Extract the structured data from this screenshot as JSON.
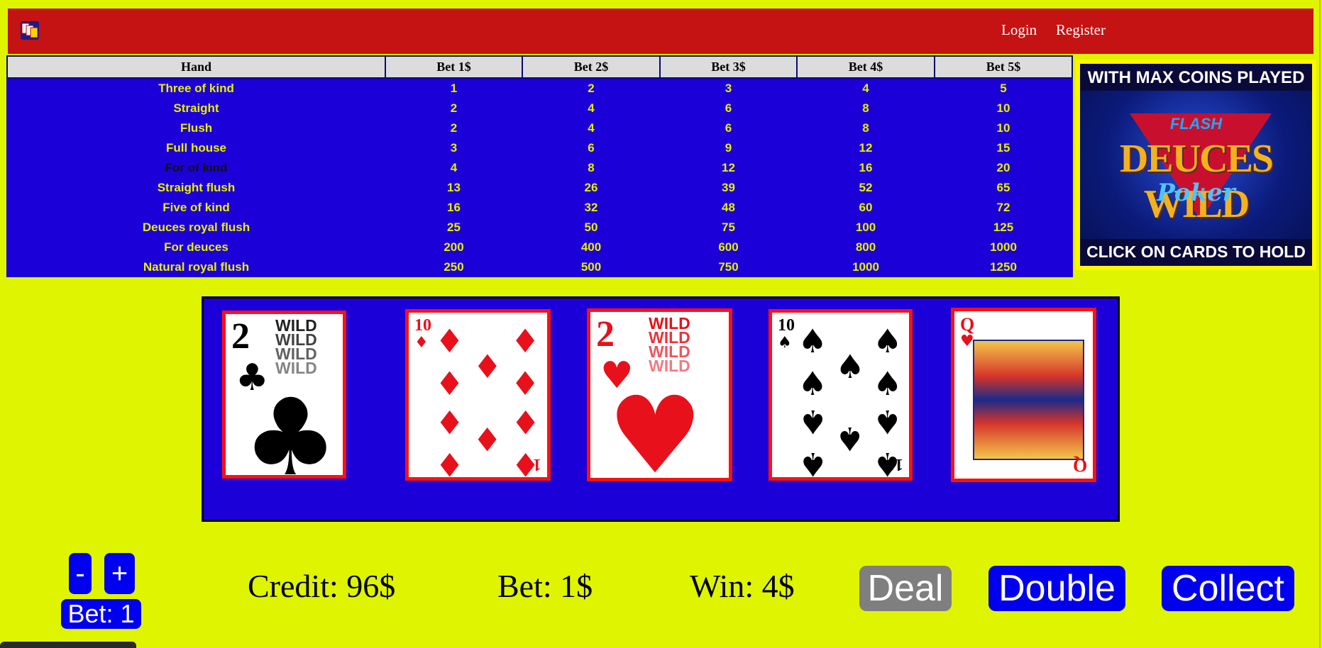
{
  "header": {
    "login_label": "Login",
    "register_label": "Register",
    "colors": {
      "background": "#c51212",
      "text": "#ffffff"
    }
  },
  "paytable": {
    "headers": [
      "Hand",
      "Bet 1$",
      "Bet 2$",
      "Bet 3$",
      "Bet 4$",
      "Bet 5$"
    ],
    "rows": [
      {
        "hand": "Three of kind",
        "pays": [
          "1",
          "2",
          "3",
          "4",
          "5"
        ]
      },
      {
        "hand": "Straight",
        "pays": [
          "2",
          "4",
          "6",
          "8",
          "10"
        ]
      },
      {
        "hand": "Flush",
        "pays": [
          "2",
          "4",
          "6",
          "8",
          "10"
        ]
      },
      {
        "hand": "Full house",
        "pays": [
          "3",
          "6",
          "9",
          "12",
          "15"
        ]
      },
      {
        "hand": "For of kind",
        "pays": [
          "4",
          "8",
          "12",
          "16",
          "20"
        ]
      },
      {
        "hand": "Straight flush",
        "pays": [
          "13",
          "26",
          "39",
          "52",
          "65"
        ]
      },
      {
        "hand": "Five of kind",
        "pays": [
          "16",
          "32",
          "48",
          "60",
          "72"
        ]
      },
      {
        "hand": "Deuces royal flush",
        "pays": [
          "25",
          "50",
          "75",
          "100",
          "125"
        ]
      },
      {
        "hand": "For deuces",
        "pays": [
          "200",
          "400",
          "600",
          "800",
          "1000"
        ]
      },
      {
        "hand": "Natural royal flush",
        "pays": [
          "250",
          "500",
          "750",
          "1000",
          "1250"
        ]
      }
    ],
    "highlighted_row_index": 4,
    "colors": {
      "background": "#1c00d8",
      "text": "#e8f000",
      "header_bg": "#dcdcdc",
      "highlighted_text": "#111111"
    }
  },
  "banner": {
    "top_text": "WITH MAX COINS PLAYED",
    "flash_text": "FLASH",
    "title_text": "DEUCES WILD",
    "script_text": "Poker",
    "bottom_text": "CLICK ON CARDS TO HOLD"
  },
  "cards": [
    {
      "rank": "2",
      "suit": "clubs",
      "suit_symbol": "♣",
      "color": "#000000",
      "wild": true,
      "wild_lines": [
        "WILD",
        "WILD",
        "WILD",
        "WILD"
      ]
    },
    {
      "rank": "10",
      "suit": "diamonds",
      "suit_symbol": "♦",
      "color": "#e8101a",
      "wild": false
    },
    {
      "rank": "2",
      "suit": "hearts",
      "suit_symbol": "♥",
      "color": "#e8101a",
      "wild": true,
      "wild_lines": [
        "WILD",
        "WILD",
        "WILD",
        "WILD"
      ]
    },
    {
      "rank": "10",
      "suit": "spades",
      "suit_symbol": "♠",
      "color": "#000000",
      "wild": false
    },
    {
      "rank": "Q",
      "suit": "hearts",
      "suit_symbol": "♥",
      "color": "#e8101a",
      "wild": false
    }
  ],
  "controls": {
    "minus_label": "-",
    "plus_label": "+",
    "bet_counter_label": "Bet: 1",
    "credit_label": "Credit: 96$",
    "bet_label": "Bet: 1$",
    "win_label": "Win: 4$",
    "deal_label": "Deal",
    "double_label": "Double",
    "collect_label": "Collect",
    "deal_enabled": false,
    "colors": {
      "button": "#0000ee",
      "disabled_button": "#7f7f7f",
      "page_bg": "#dff400"
    }
  }
}
